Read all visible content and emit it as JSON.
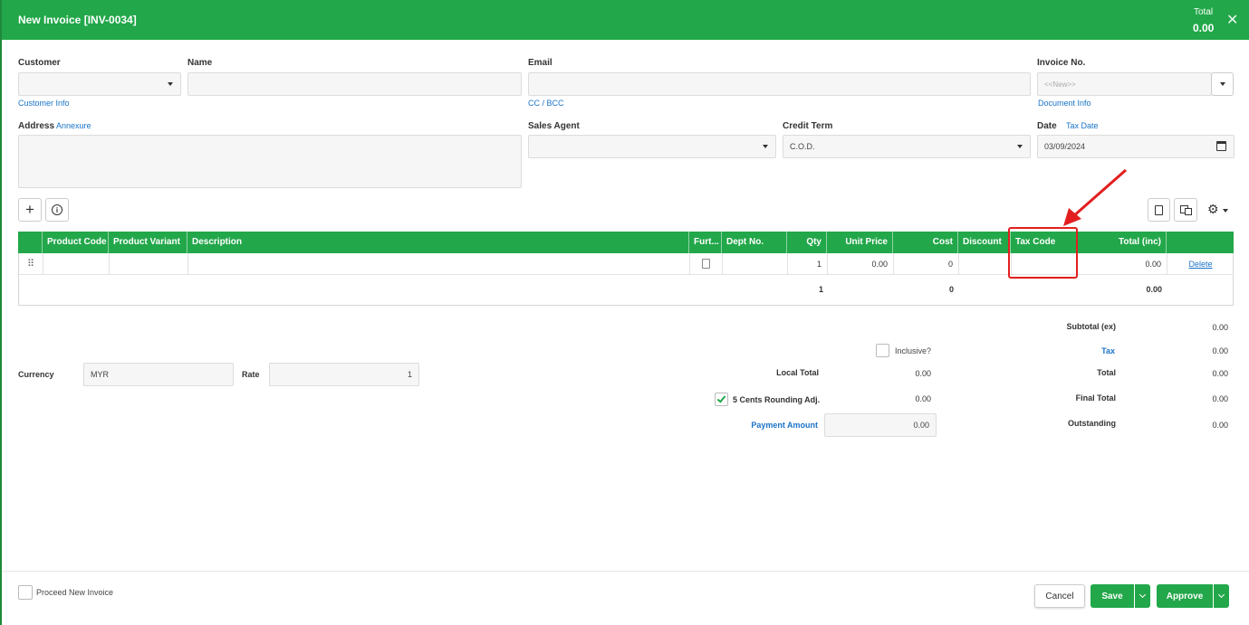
{
  "header": {
    "title": "New Invoice [INV-0034]",
    "total_label": "Total",
    "total_value": "0.00",
    "close": "✕"
  },
  "form": {
    "customer_label": "Customer",
    "customer_info_link": "Customer Info",
    "name_label": "Name",
    "email_label": "Email",
    "cc_bcc_link": "CC / BCC",
    "invoice_no_label": "Invoice No.",
    "invoice_no_placeholder": "<<New>>",
    "document_info_link": "Document Info",
    "address_label": "Address",
    "annexure_link": "Annexure",
    "sales_agent_label": "Sales Agent",
    "credit_term_label": "Credit Term",
    "credit_term_value": "C.O.D.",
    "date_label": "Date",
    "tax_date_link": "Tax Date",
    "date_value": "03/09/2024"
  },
  "grid": {
    "columns": [
      "Product Code",
      "Product Variant",
      "Description",
      "Furt...",
      "Dept No.",
      "Qty",
      "Unit Price",
      "Cost",
      "Discount",
      "Tax Code",
      "Total (inc)"
    ],
    "row": {
      "qty": "1",
      "unit_price": "0.00",
      "cost": "0",
      "total": "0.00",
      "delete": "Delete"
    },
    "totals": {
      "qty": "1",
      "cost": "0",
      "total": "0.00"
    }
  },
  "summary": {
    "currency_label": "Currency",
    "currency_value": "MYR",
    "rate_label": "Rate",
    "rate_value": "1",
    "inclusive_label": "Inclusive?",
    "local_total_label": "Local Total",
    "local_total_value": "0.00",
    "rounding_label": "5 Cents Rounding Adj.",
    "rounding_value": "0.00",
    "payment_amount_label": "Payment Amount",
    "payment_amount_value": "0.00",
    "subtotal_label": "Subtotal (ex)",
    "subtotal_value": "0.00",
    "tax_label": "Tax",
    "tax_value": "0.00",
    "total_label": "Total",
    "total_value": "0.00",
    "final_total_label": "Final Total",
    "final_total_value": "0.00",
    "outstanding_label": "Outstanding",
    "outstanding_value": "0.00"
  },
  "footer": {
    "proceed_label": "Proceed New Invoice",
    "cancel": "Cancel",
    "save": "Save",
    "approve": "Approve"
  },
  "colors": {
    "accent": "#22a74a",
    "link": "#1a73c7",
    "highlight": "#e31e1e"
  }
}
